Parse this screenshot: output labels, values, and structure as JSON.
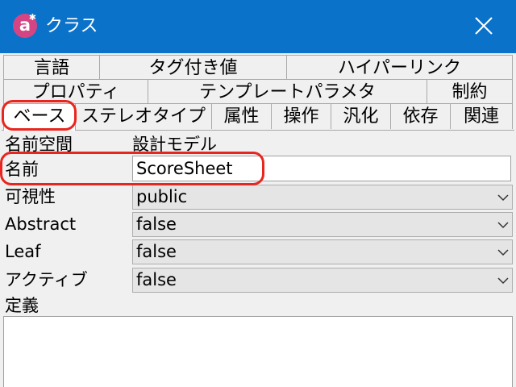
{
  "window": {
    "title": "クラス",
    "app_icon": "astah-icon",
    "titlebar_color": "#0b72c9"
  },
  "tabs": {
    "row1": [
      "言語",
      "タグ付き値",
      "ハイパーリンク"
    ],
    "row2": [
      "プロパティ",
      "テンプレートパラメタ",
      "制約"
    ],
    "row3": [
      "ベース",
      "ステレオタイプ",
      "属性",
      "操作",
      "汎化",
      "依存",
      "関連"
    ],
    "active": "ベース"
  },
  "properties": {
    "namespace": {
      "label": "名前空間",
      "value": "設計モデル"
    },
    "name": {
      "label": "名前",
      "value": "ScoreSheet"
    },
    "visibility": {
      "label": "可視性",
      "value": "public"
    },
    "abstract": {
      "label": "Abstract",
      "value": "false"
    },
    "leaf": {
      "label": "Leaf",
      "value": "false"
    },
    "active": {
      "label": "アクティブ",
      "value": "false"
    },
    "definition": {
      "label": "定義",
      "value": ""
    }
  },
  "highlight_color": "#e8251f"
}
